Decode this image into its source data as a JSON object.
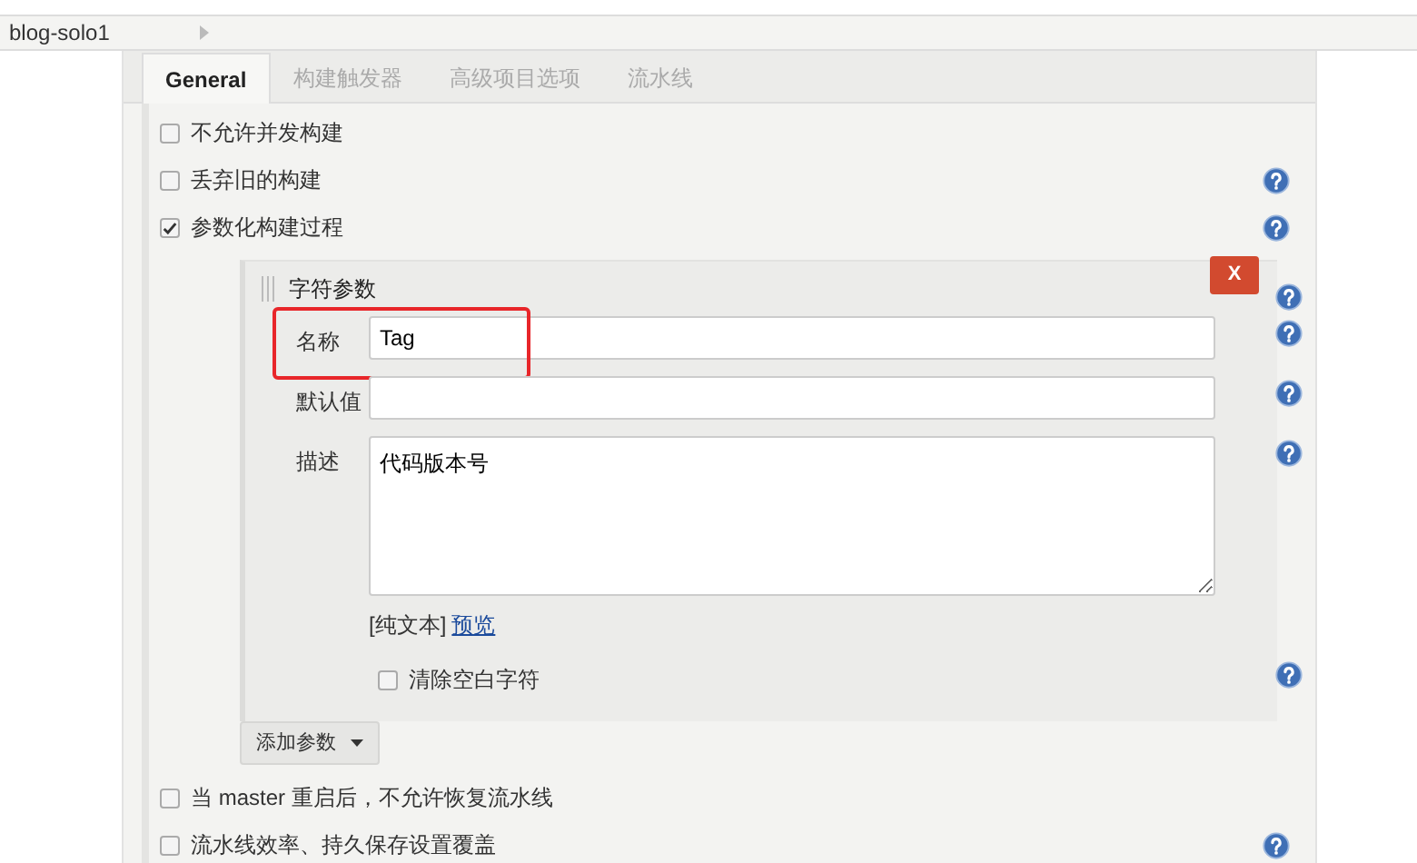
{
  "breadcrumb": {
    "items": [
      "blog-solo1"
    ]
  },
  "tabs": [
    {
      "label": "General",
      "selected": true
    },
    {
      "label": "构建触发器",
      "selected": false
    },
    {
      "label": "高级项目选项",
      "selected": false
    },
    {
      "label": "流水线",
      "selected": false
    }
  ],
  "options_top": [
    {
      "label": "不允许并发构建",
      "checked": false,
      "help": false
    },
    {
      "label": "丢弃旧的构建",
      "checked": false,
      "help": true
    },
    {
      "label": "参数化构建过程",
      "checked": true,
      "help": true
    }
  ],
  "parameter": {
    "title": "字符参数",
    "delete_label": "X",
    "fields": [
      {
        "label": "名称",
        "value": "Tag",
        "kind": "input",
        "highlighted": true
      },
      {
        "label": "默认值",
        "kind": "input",
        "highlighted": false
      },
      {
        "label": "描述",
        "value": "代码版本号",
        "kind": "textarea",
        "highlighted": false
      }
    ],
    "format": "[纯文本]",
    "preview_link": "预览",
    "trim": {
      "label": "清除空白字符",
      "checked": false
    }
  },
  "add_button": {
    "label": "添加参数"
  },
  "options_bottom": [
    {
      "label": "当 master 重启后，不允许恢复流水线",
      "checked": false,
      "help": false
    },
    {
      "label": "流水线效率、持久保存设置覆盖",
      "checked": false,
      "help": true
    }
  ]
}
